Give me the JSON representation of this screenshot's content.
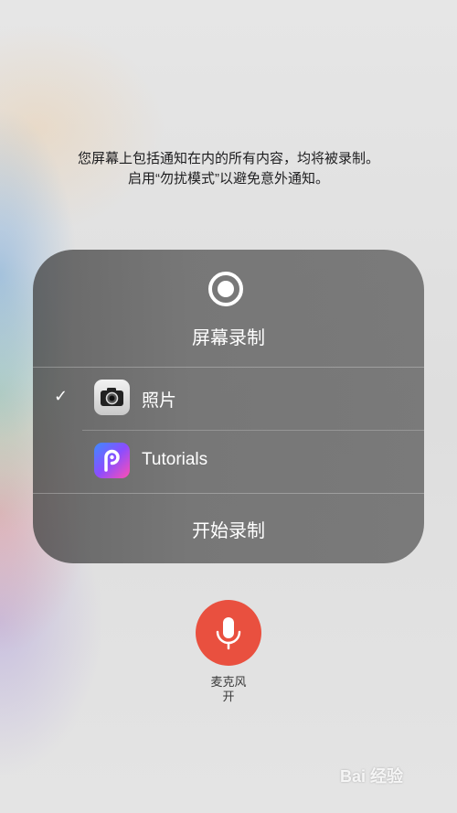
{
  "warning": {
    "line1": "您屏幕上包括通知在内的所有内容，均将被录制。",
    "line2": "启用“勿扰模式”以避免意外通知。"
  },
  "panel": {
    "title": "屏幕录制",
    "record_icon": "record-icon",
    "destinations": [
      {
        "label": "照片",
        "icon": "camera-icon",
        "selected": true,
        "check": "✓"
      },
      {
        "label": "Tutorials",
        "icon": "picsart-icon",
        "selected": false
      }
    ],
    "start_label": "开始录制"
  },
  "microphone": {
    "icon": "microphone-icon",
    "label": "麦克风",
    "state": "开",
    "color": "#e9503f"
  },
  "watermark": {
    "text": "Bai 经验"
  }
}
